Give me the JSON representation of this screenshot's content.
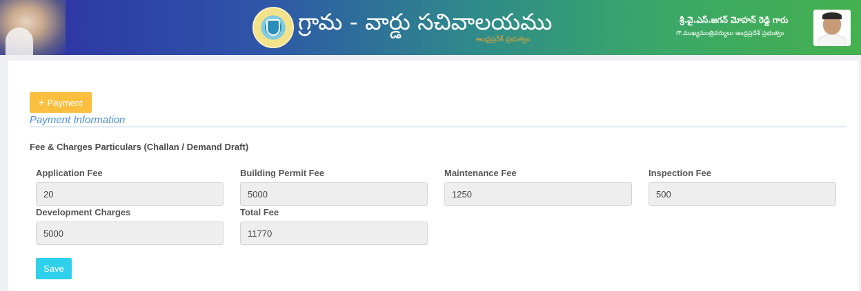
{
  "header": {
    "title": "గ్రామ - వార్డు సచివాలయము",
    "subtitle": "ఆంధ్రప్రదేశ్ ప్రభుత్వం",
    "cm_name": "శ్రీ.వై.ఎస్.జగన్ మోహన్ రెడ్డి గారు",
    "cm_designation": "గౌ.ముఖ్యమంత్రివర్యులు ఆంధ్రప్రదేశ్ ప్రభుత్వం"
  },
  "payment_button": {
    "icon": "plus-icon",
    "label": "Payment"
  },
  "section_title": "Payment Information",
  "fee_heading": "Fee & Charges Particulars (Challan / Demand Draft)",
  "fields": {
    "application_fee": {
      "label": "Application Fee",
      "value": "20"
    },
    "building_permit_fee": {
      "label": "Building Permit Fee",
      "value": "5000"
    },
    "maintenance_fee": {
      "label": "Maintenance Fee",
      "value": "1250"
    },
    "inspection_fee": {
      "label": "Inspection Fee",
      "value": "500"
    },
    "development_charges": {
      "label": "Development Charges",
      "value": "5000"
    },
    "total_fee": {
      "label": "Total Fee",
      "value": "11770"
    }
  },
  "save_label": "Save",
  "colors": {
    "payment_button": "#fbbf3f",
    "save_button": "#2fd0ec",
    "section_title": "#4a8fd0",
    "subtitle": "#e0a53a"
  }
}
